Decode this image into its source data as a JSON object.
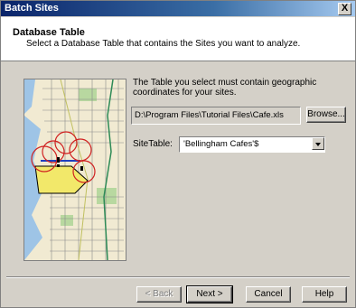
{
  "window": {
    "title": "Batch Sites",
    "close_label": "X"
  },
  "header": {
    "title": "Database Table",
    "subtitle": "Select a Database Table that contains the Sites you want to analyze."
  },
  "body": {
    "description": "The Table you select must contain geographic coordinates for your sites.",
    "file_path": "D:\\Program Files\\Tutorial Files\\Cafe.xls",
    "browse_label": "Browse...",
    "site_table_label": "SiteTable:",
    "site_table_value": "'Bellingham Cafes'$"
  },
  "footer": {
    "back_label": "< Back",
    "next_label": "Next >",
    "cancel_label": "Cancel",
    "help_label": "Help"
  }
}
